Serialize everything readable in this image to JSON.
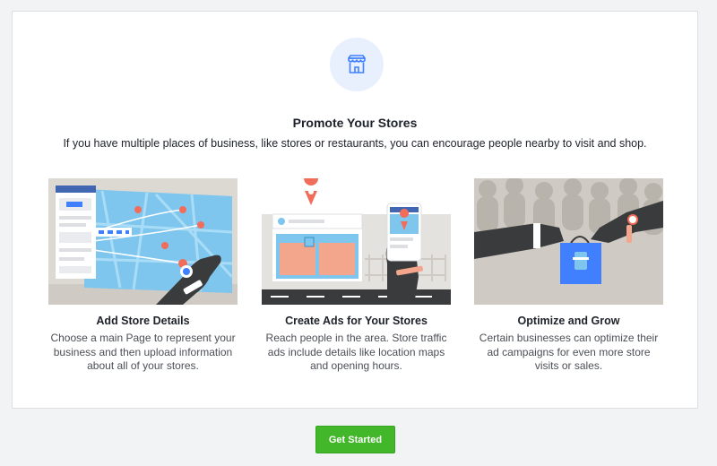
{
  "colors": {
    "accent_blue": "#4080ff",
    "cta_green": "#42b72a",
    "map_blue": "#7ec6ee",
    "dark_skin": "#3a3b3c"
  },
  "header": {
    "icon": "store-icon",
    "title": "Promote Your Stores",
    "subtitle": "If you have multiple places of business, like stores or restaurants, you can encourage people nearby to visit and shop."
  },
  "features": [
    {
      "icon": "map-illustration",
      "title": "Add Store Details",
      "description": "Choose a main Page to represent your business and then upload information about all of your stores."
    },
    {
      "icon": "storefront-phone-illustration",
      "title": "Create Ads for Your Stores",
      "description": "Reach people in the area. Store traffic ads include details like location maps and opening hours."
    },
    {
      "icon": "handshake-bag-illustration",
      "title": "Optimize and Grow",
      "description": "Certain businesses can optimize their ad campaigns for even more store visits or sales."
    }
  ],
  "cta": {
    "label": "Get Started"
  }
}
